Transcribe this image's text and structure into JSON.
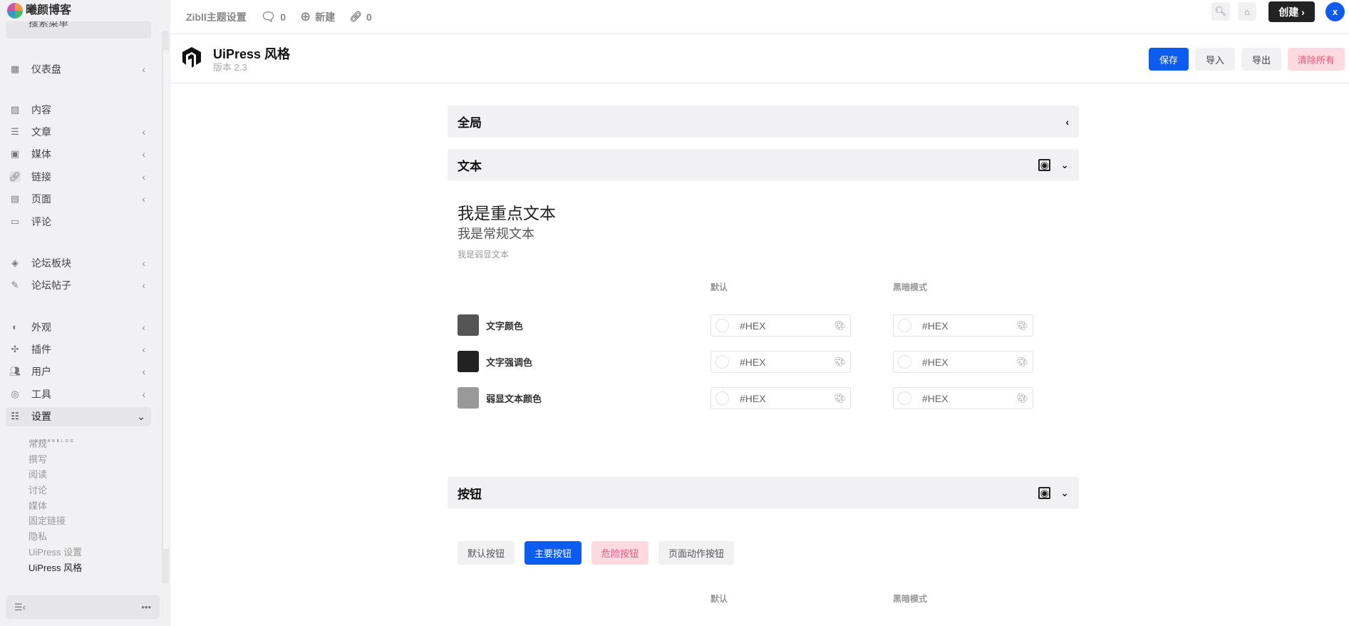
{
  "brand": {
    "name": "曦颜博客",
    "sub": "XIYANBLOG"
  },
  "sidebar": {
    "clipped_item": "搜索菜单",
    "items": [
      {
        "label": "仪表盘",
        "icon": "grid-icon"
      },
      {
        "label": "内容",
        "icon": "images-icon"
      },
      {
        "label": "文章",
        "icon": "document-icon"
      },
      {
        "label": "媒体",
        "icon": "media-icon"
      },
      {
        "label": "链接",
        "icon": "link-icon"
      },
      {
        "label": "页面",
        "icon": "page-icon"
      },
      {
        "label": "评论",
        "icon": "comment-icon"
      },
      {
        "label": "论坛板块",
        "icon": "forum-icon"
      },
      {
        "label": "论坛帖子",
        "icon": "post-icon"
      },
      {
        "label": "外观",
        "icon": "palette-icon"
      },
      {
        "label": "插件",
        "icon": "plugin-icon"
      },
      {
        "label": "用户",
        "icon": "users-icon"
      },
      {
        "label": "工具",
        "icon": "tools-icon"
      },
      {
        "label": "设置",
        "icon": "sliders-icon"
      }
    ],
    "submenu": [
      "常规",
      "撰写",
      "阅读",
      "讨论",
      "媒体",
      "固定链接",
      "隐私",
      "UiPress 设置",
      "UiPress 风格"
    ],
    "more": "•••"
  },
  "topbar": {
    "site": "Zibll主题设置",
    "comments": "0",
    "new": "新建",
    "links": "0",
    "create": "创建",
    "avatar": "x"
  },
  "header": {
    "title": "UiPress 风格",
    "version": "版本 2.3",
    "save": "保存",
    "import": "导入",
    "export": "导出",
    "clear": "清除所有"
  },
  "sections": {
    "global": "全局",
    "text": "文本",
    "buttons": "按钮"
  },
  "text_section": {
    "sample_strong": "我是重点文本",
    "sample_regular": "我是常规文本",
    "sample_muted": "我是弱显文本",
    "col_default": "默认",
    "col_dark": "黑暗模式",
    "rows": [
      {
        "label": "文字颜色",
        "color": "#555555",
        "default": "#HEX",
        "dark": "#HEX"
      },
      {
        "label": "文字强调色",
        "color": "#222222",
        "default": "#HEX",
        "dark": "#HEX"
      },
      {
        "label": "弱显文本颜色",
        "color": "#999999",
        "default": "#HEX",
        "dark": "#HEX"
      }
    ]
  },
  "buttons_section": {
    "default": "默认按钮",
    "primary": "主要按钮",
    "danger": "危险按钮",
    "page_action": "页面动作按钮",
    "col_default": "默认",
    "col_dark": "黑暗模式"
  },
  "colors": {
    "primary": "#0c5cef",
    "danger_bg": "#fdd9e0",
    "danger_text": "#e9557a"
  }
}
